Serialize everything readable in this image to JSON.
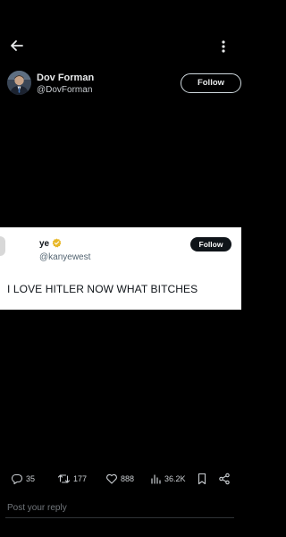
{
  "header": {
    "back_icon": "arrow-left-icon",
    "more_icon": "more-vertical-icon"
  },
  "post": {
    "author_name": "Dov Forman",
    "author_handle": "@DovForman",
    "follow_label": "Follow"
  },
  "embedded_tweet": {
    "name": "ye",
    "handle": "@kanyewest",
    "follow_label": "Follow",
    "text": "I LOVE HITLER    NOW WHAT BITCHES",
    "verified_color": "#E8B829"
  },
  "actions": {
    "replies": "35",
    "reposts": "177",
    "likes": "888",
    "views": "36.2K"
  },
  "reply": {
    "placeholder": "Post your reply"
  },
  "colors": {
    "background": "#000000",
    "text": "#E7E9EA",
    "muted": "#71767B"
  }
}
